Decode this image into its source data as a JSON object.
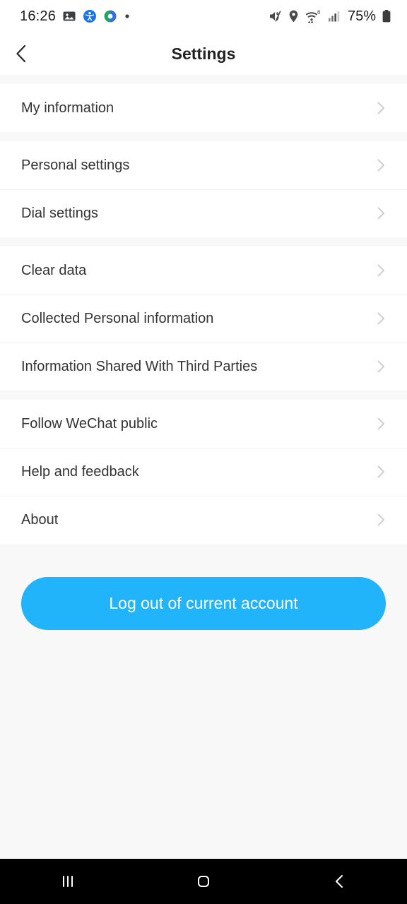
{
  "status_bar": {
    "time": "16:26",
    "battery_percent": "75%",
    "left_icons": [
      "photo-icon",
      "accessibility-icon",
      "sync-icon",
      "dot-icon"
    ],
    "right_icons": [
      "mute-icon",
      "location-icon",
      "wifi-6-icon",
      "cellular-signal-icon",
      "battery-icon"
    ],
    "wifi_generation": "6"
  },
  "header": {
    "title": "Settings",
    "back_icon": "chevron-left-icon"
  },
  "sections": [
    {
      "rows": [
        {
          "label": "My information",
          "accessory": "chevron-right-icon"
        }
      ]
    },
    {
      "rows": [
        {
          "label": "Personal settings",
          "accessory": "chevron-right-icon"
        },
        {
          "label": "Dial settings",
          "accessory": "chevron-right-icon"
        }
      ]
    },
    {
      "rows": [
        {
          "label": "Clear data",
          "accessory": "chevron-right-icon"
        },
        {
          "label": "Collected Personal information",
          "accessory": "chevron-right-icon"
        },
        {
          "label": "Information Shared With Third Parties",
          "accessory": "chevron-right-icon"
        }
      ]
    },
    {
      "rows": [
        {
          "label": "Follow WeChat public",
          "accessory": "chevron-right-icon"
        },
        {
          "label": "Help and feedback",
          "accessory": "chevron-right-icon"
        },
        {
          "label": "About",
          "accessory": "chevron-right-icon"
        }
      ]
    }
  ],
  "logout": {
    "label": "Log out of current account"
  },
  "nav_bar": {
    "recents_icon": "recents-icon",
    "home_icon": "home-icon",
    "back_icon": "back-icon"
  },
  "colors": {
    "accent": "#22b4fb",
    "page_background": "#f8f8f8",
    "row_background": "#ffffff",
    "primary_text": "#333333",
    "title_text": "#222222",
    "chevron": "#cfcfcf",
    "divider": "#f2f2f2",
    "nav_background": "#000000"
  }
}
